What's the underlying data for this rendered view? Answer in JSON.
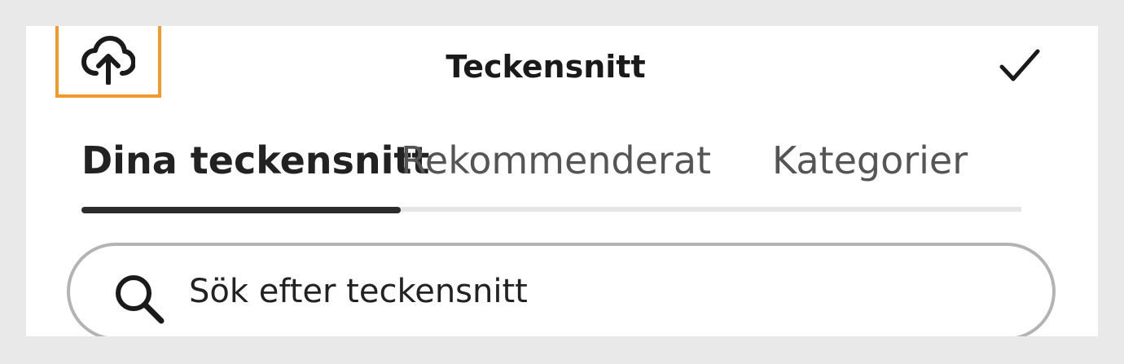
{
  "header": {
    "title": "Teckensnitt",
    "upload_icon": "cloud-upload-icon",
    "done_icon": "checkmark-icon",
    "highlight_color": "#f29a2e"
  },
  "tabs": [
    {
      "label": "Dina teckensnitt",
      "active": true
    },
    {
      "label": "Rekommenderat",
      "active": false
    },
    {
      "label": "Kategorier",
      "active": false
    }
  ],
  "search": {
    "placeholder": "Sök efter teckensnitt",
    "value": "",
    "icon": "search-icon"
  }
}
